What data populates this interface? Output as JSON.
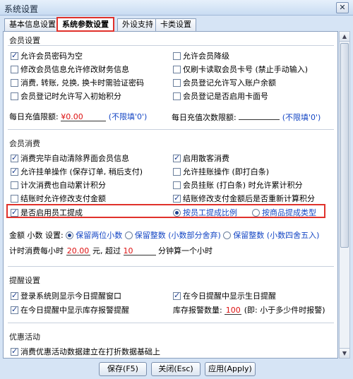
{
  "window": {
    "title": "系统设置",
    "close_glyph": "✕"
  },
  "tabs": [
    "基本信息设置",
    "系统参数设置",
    "外设支持",
    "卡类设置"
  ],
  "member_settings": {
    "title": "会员设置",
    "left": [
      {
        "label": "允许会员密码为空",
        "checked": true
      },
      {
        "label": "修改会员信息允许修改财务信息",
        "checked": false
      },
      {
        "label": "消费, 转账, 兑换, 换卡时需验证密码",
        "checked": false
      },
      {
        "label": "会员登记时允许写入初始积分",
        "checked": false
      }
    ],
    "right": [
      {
        "label": "允许会员降级",
        "checked": false
      },
      {
        "label": "仅刷卡读取会员卡号 (禁止手动输入)",
        "checked": false
      },
      {
        "label": "会员登记允许写入账户余额",
        "checked": false
      },
      {
        "label": "会员登记是否启用卡面号",
        "checked": false
      }
    ],
    "daily_limit_label": "每日充值限额:",
    "daily_limit_value": "¥0.00",
    "daily_limit_hint": "(不限填'0')",
    "daily_count_label": "每日充值次数限额:",
    "daily_count_hint": "(不限填'0')"
  },
  "member_consume": {
    "title": "会员消费",
    "left": [
      {
        "label": "消费完毕自动清除界面会员信息",
        "checked": true
      },
      {
        "label": "允许挂单操作 (保存订单, 稍后支付)",
        "checked": true
      },
      {
        "label": "计次消费也自动累计积分",
        "checked": false
      },
      {
        "label": "结账时允许修改支付金额",
        "checked": false
      },
      {
        "label": "是否启用员工提成",
        "checked": true
      }
    ],
    "right": [
      {
        "label": "启用散客消费",
        "checked": true
      },
      {
        "label": "允许挂账操作 (即打白条)",
        "checked": false
      },
      {
        "label": "会员挂账 (打白条) 时允许累计积分",
        "checked": false
      },
      {
        "label": "结账修改支付金额后是否重新计算积分",
        "checked": true
      }
    ],
    "commission_by_ratio": "按员工提成比例",
    "commission_by_product": "按商品提成类型",
    "amount_label": "金额 小数 设置:",
    "amount_options": [
      "保留两位小数",
      "保留整数 (小数部分舍弃)",
      "保留整数 (小数四舍五入)"
    ],
    "timer_prefix": "计时消费每小时",
    "timer_price": "20.00",
    "timer_mid": "元, 超过",
    "timer_minutes": "10",
    "timer_suffix": "分钟算一个小时"
  },
  "reminder": {
    "title": "提醒设置",
    "items": [
      {
        "label": "登录系统则显示今日提醒窗口",
        "checked": true
      },
      {
        "label": "在今日提醒中显示生日提醒",
        "checked": true
      },
      {
        "label": "在今日提醒中显示库存报警提醒",
        "checked": true
      }
    ],
    "stock_label": "库存报警数量:",
    "stock_value": "100",
    "stock_hint": "(即: 小于多少件时报警)"
  },
  "promo": {
    "title": "优惠活动",
    "items": [
      {
        "label": "消费优惠活动数据建立在打折数据基础上",
        "checked": true
      }
    ]
  },
  "buttons": {
    "save": "保存(F5)",
    "close": "关闭(Esc)",
    "apply": "应用(Apply)"
  }
}
